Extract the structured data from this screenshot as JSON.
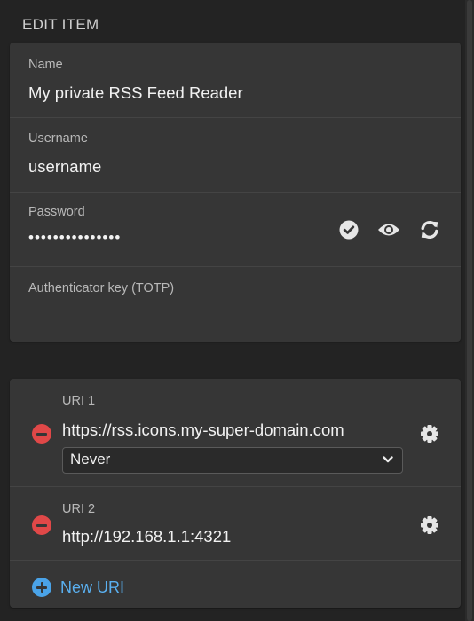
{
  "section": {
    "title": "EDIT ITEM"
  },
  "login": {
    "name_label": "Name",
    "name_value": "My private RSS Feed Reader",
    "username_label": "Username",
    "username_value": "username",
    "password_label": "Password",
    "password_value": "•••••••••••••••",
    "totp_label": "Authenticator key (TOTP)",
    "totp_value": "",
    "password_actions": [
      "check-password-icon",
      "toggle-visibility-icon",
      "generate-password-icon"
    ]
  },
  "uris": {
    "items": [
      {
        "label": "URI 1",
        "value": "https://rss.icons.my-super-domain.com",
        "match_detection": "Never"
      },
      {
        "label": "URI 2",
        "value": "http://192.168.1.1:4321"
      }
    ],
    "new_uri_label": "New URI"
  },
  "colors": {
    "background": "#232323",
    "card": "#363636",
    "remove": "#e04848",
    "accent": "#4aa3e8",
    "link": "#5ab0f0"
  }
}
